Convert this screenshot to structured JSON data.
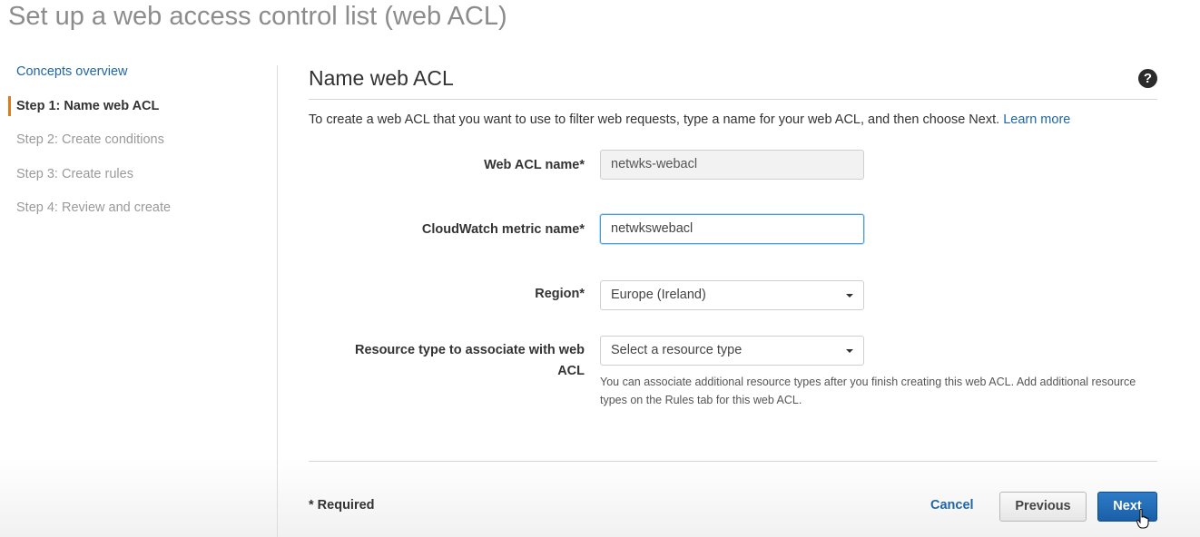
{
  "page": {
    "title": "Set up a web access control list (web ACL)"
  },
  "nav": {
    "concepts": "Concepts overview",
    "step1": "Step 1: Name web ACL",
    "step2": "Step 2: Create conditions",
    "step3": "Step 3: Create rules",
    "step4": "Step 4: Review and create"
  },
  "panel": {
    "title": "Name web ACL",
    "help_icon": "?",
    "intro": "To create a web ACL that you want to use to filter web requests, type a name for your web ACL, and then choose Next.",
    "learn_more": "Learn more"
  },
  "form": {
    "webacl_name_label": "Web ACL name*",
    "webacl_name_value": "netwks-webacl",
    "metric_label": "CloudWatch metric name*",
    "metric_value": "netwkswebacl",
    "region_label": "Region*",
    "region_value": "Europe (Ireland)",
    "resource_label": "Resource type to associate with web ACL",
    "resource_value": "Select a resource type",
    "resource_hint": "You can associate additional resource types after you finish creating this web ACL. Add additional resource types on the Rules tab for this web ACL."
  },
  "footer": {
    "required_note": "* Required",
    "cancel": "Cancel",
    "previous": "Previous",
    "next": "Next"
  },
  "colors": {
    "accent": "#e07b1d",
    "link": "#1f66a8",
    "primary_button": "#1a5fa8"
  }
}
